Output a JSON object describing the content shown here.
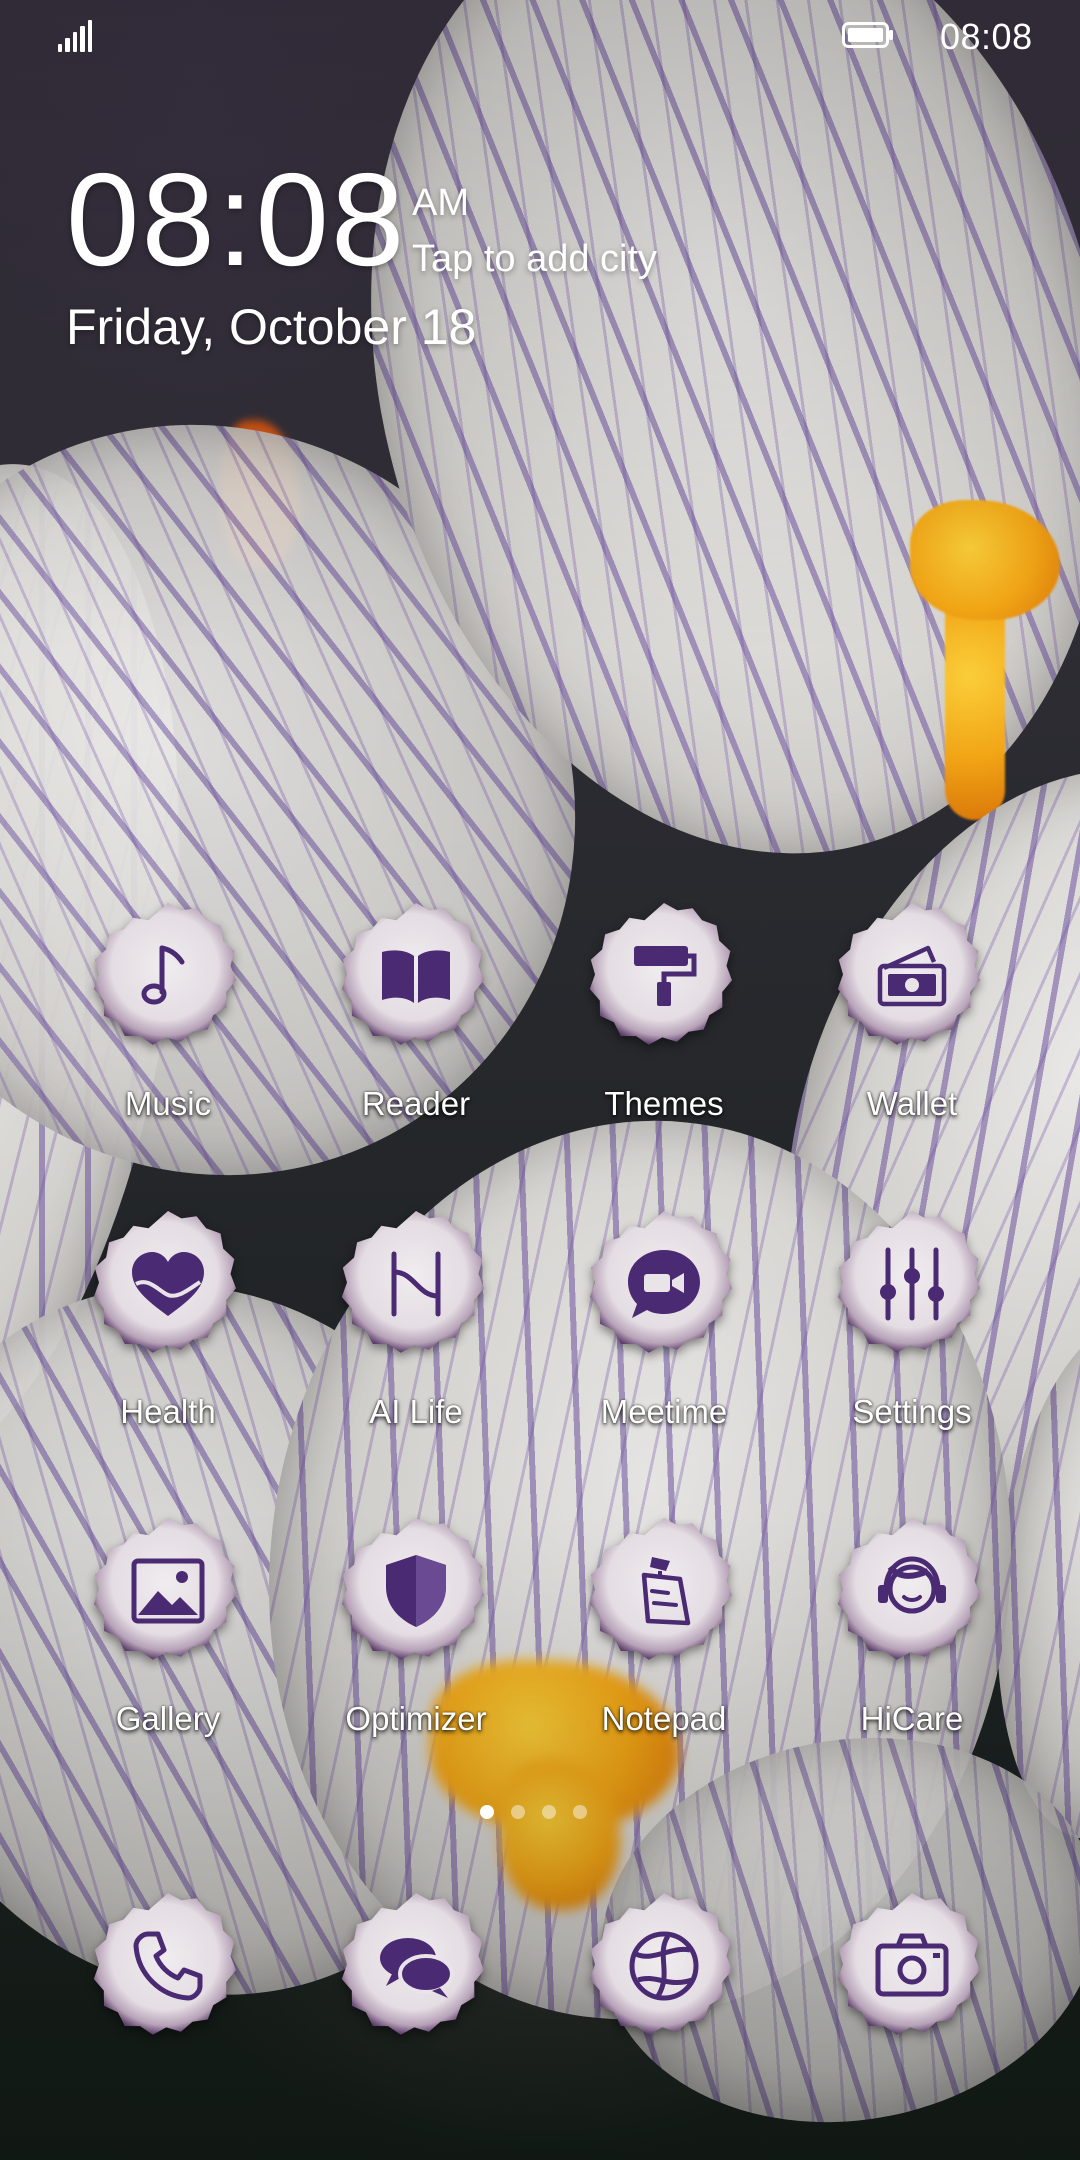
{
  "status_bar": {
    "time": "08:08"
  },
  "clock": {
    "time": "08:08",
    "ampm": "AM",
    "city_hint": "Tap to add city",
    "date": "Friday, October 18"
  },
  "apps": {
    "music": {
      "label": "Music",
      "icon": "music-note-icon"
    },
    "reader": {
      "label": "Reader",
      "icon": "open-book-icon"
    },
    "themes": {
      "label": "Themes",
      "icon": "paint-roller-icon"
    },
    "wallet": {
      "label": "Wallet",
      "icon": "wallet-icon"
    },
    "health": {
      "label": "Health",
      "icon": "heart-icon"
    },
    "ailife": {
      "label": "AI Life",
      "icon": "ai-life-icon"
    },
    "meetime": {
      "label": "Meetime",
      "icon": "video-call-icon"
    },
    "settings": {
      "label": "Settings",
      "icon": "sliders-icon"
    },
    "gallery": {
      "label": "Gallery",
      "icon": "picture-icon"
    },
    "optimizer": {
      "label": "Optimizer",
      "icon": "shield-icon"
    },
    "notepad": {
      "label": "Notepad",
      "icon": "notepad-icon"
    },
    "hicare": {
      "label": "HiCare",
      "icon": "headset-icon"
    }
  },
  "dock": {
    "phone": {
      "icon": "phone-icon"
    },
    "messages": {
      "icon": "chat-bubbles-icon"
    },
    "browser": {
      "icon": "globe-icon"
    },
    "camera": {
      "icon": "camera-icon"
    }
  },
  "home_pages": {
    "count": 4,
    "current": 1
  },
  "colors": {
    "icon_accent": "#4a2a73",
    "icon_badge": "#e9e4e8",
    "icon_badge_edge": "#6b4f7d",
    "text": "#ffffff"
  }
}
